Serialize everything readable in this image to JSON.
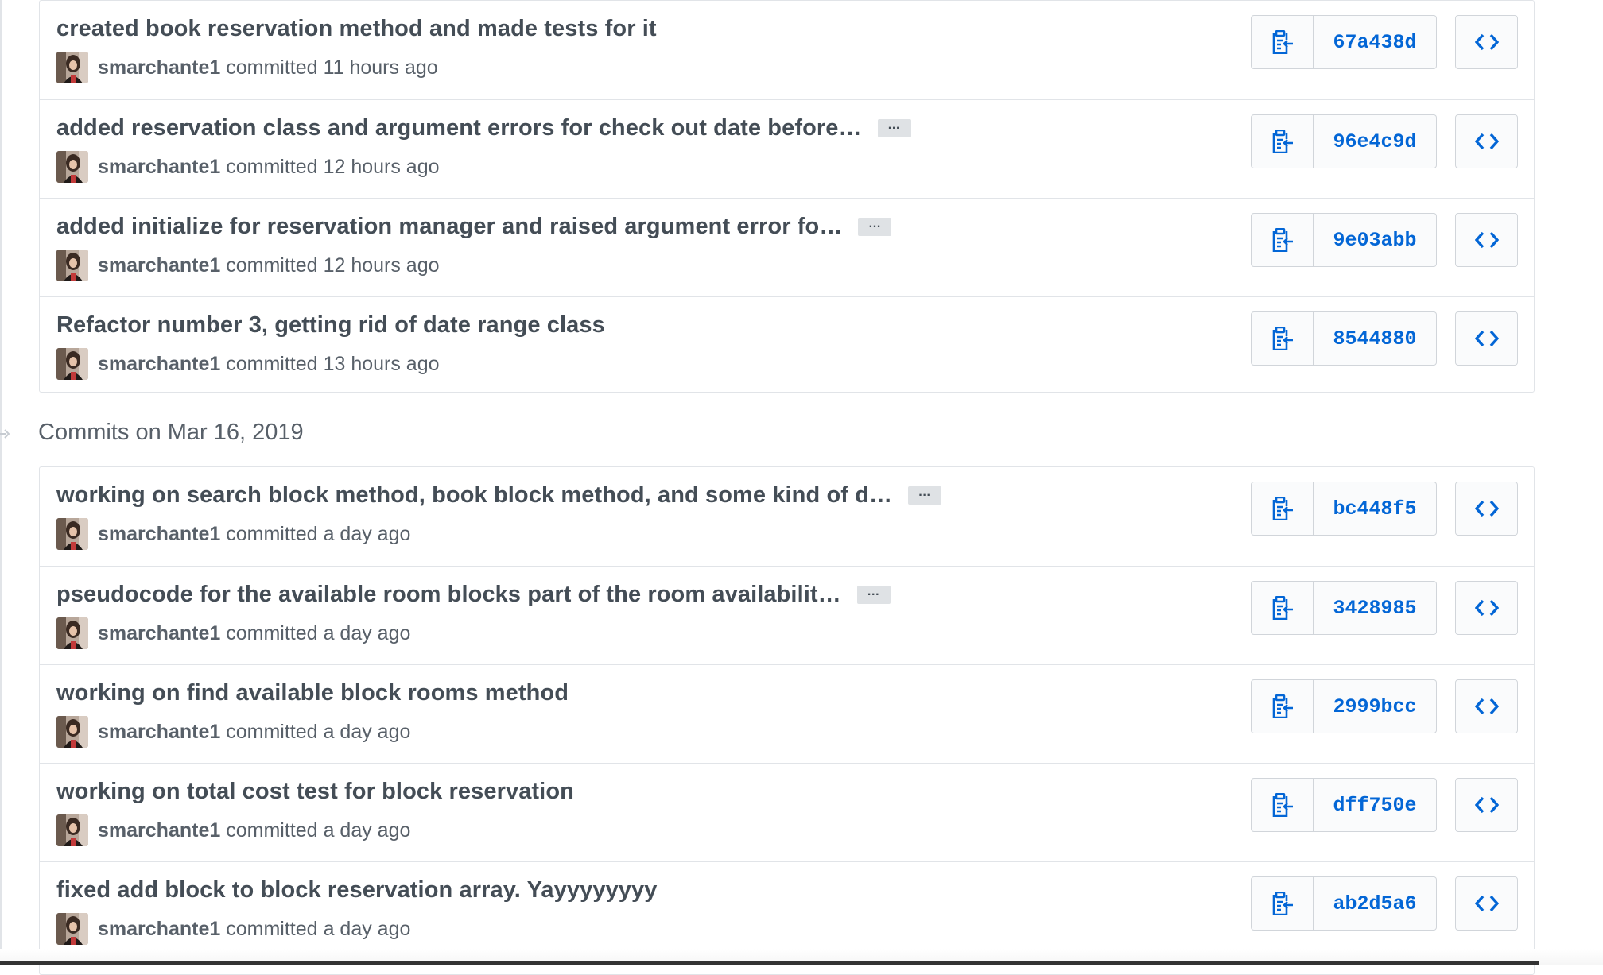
{
  "date_header": "Commits on Mar 16, 2019",
  "colors": {
    "sha_link": "#0366d6",
    "title_text": "#444d56",
    "meta_text": "#586069",
    "border": "#e1e4e8"
  },
  "icons": {
    "copy": "clipboard-icon",
    "browse": "code-icon",
    "expand": "ellipsis-icon",
    "timeline": "timeline-marker-icon"
  },
  "groups": [
    {
      "commits": [
        {
          "title": "created book reservation method and made tests for it",
          "has_more": false,
          "author": "smarchante1",
          "action": "committed",
          "time": "11 hours ago",
          "sha": "67a438d"
        },
        {
          "title": "added reservation class and argument errors for check out date before…",
          "has_more": true,
          "more_label": "…",
          "author": "smarchante1",
          "action": "committed",
          "time": "12 hours ago",
          "sha": "96e4c9d"
        },
        {
          "title": "added initialize for reservation manager and raised argument error fo…",
          "has_more": true,
          "more_label": "…",
          "author": "smarchante1",
          "action": "committed",
          "time": "12 hours ago",
          "sha": "9e03abb"
        },
        {
          "title": "Refactor number 3, getting rid of date range class",
          "has_more": false,
          "author": "smarchante1",
          "action": "committed",
          "time": "13 hours ago",
          "sha": "8544880"
        }
      ]
    },
    {
      "commits": [
        {
          "title": "working on search block method, book block method, and some kind of d…",
          "has_more": true,
          "more_label": "…",
          "author": "smarchante1",
          "action": "committed",
          "time": "a day ago",
          "sha": "bc448f5"
        },
        {
          "title": "pseudocode for the available room blocks part of the room availabilit…",
          "has_more": true,
          "more_label": "…",
          "author": "smarchante1",
          "action": "committed",
          "time": "a day ago",
          "sha": "3428985"
        },
        {
          "title": "working on find available block rooms method",
          "has_more": false,
          "author": "smarchante1",
          "action": "committed",
          "time": "a day ago",
          "sha": "2999bcc"
        },
        {
          "title": "working on total cost test for block reservation",
          "has_more": false,
          "author": "smarchante1",
          "action": "committed",
          "time": "a day ago",
          "sha": "dff750e"
        },
        {
          "title": "fixed add block to block reservation array. Yayyyyyyyy",
          "has_more": false,
          "author": "smarchante1",
          "action": "committed",
          "time": "a day ago",
          "sha": "ab2d5a6"
        }
      ]
    }
  ]
}
